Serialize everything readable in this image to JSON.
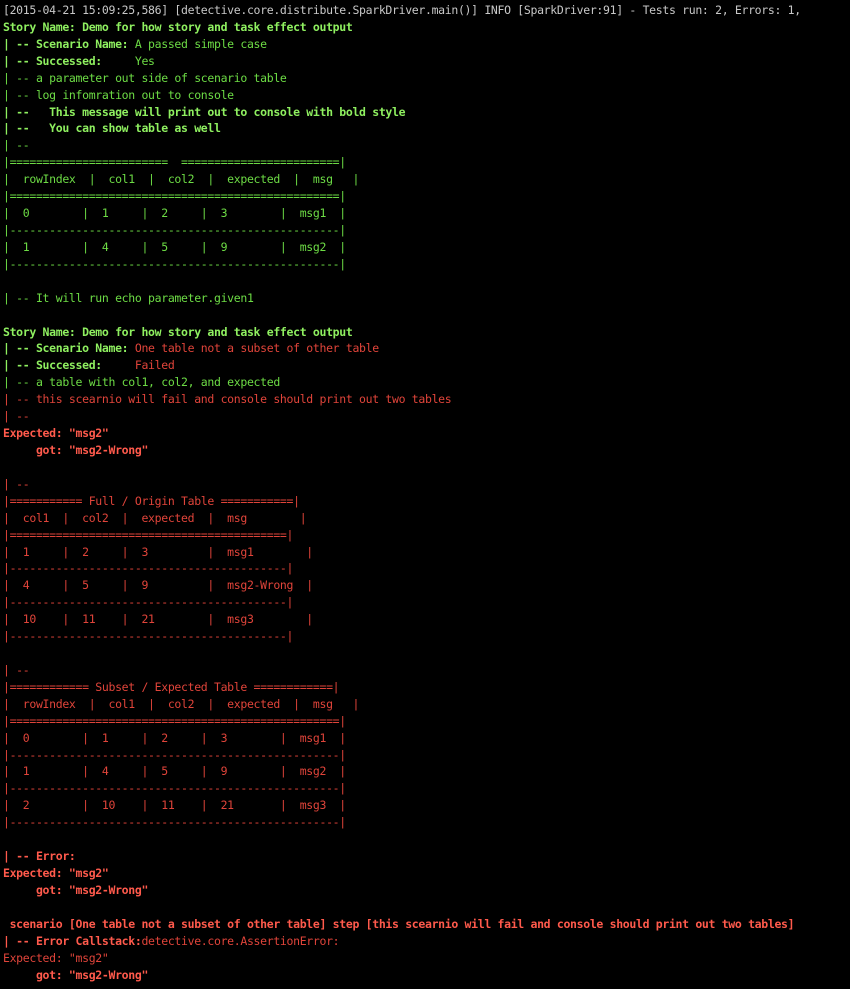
{
  "colors": {
    "background": "#000000",
    "log": "#c8c8c8",
    "green": "#6ddc45",
    "green_bright": "#8ff060",
    "red": "#e0443a",
    "red_bright": "#ff5a4c"
  },
  "lines": [
    [
      {
        "t": "[2015-04-21 15:09:25,586] [detective.core.distribute.SparkDriver.main()] INFO [SparkDriver:91] - Tests run: 2, Errors: 1,",
        "c": "log"
      }
    ],
    [
      {
        "t": "Story Name: Demo for how story and task effect output",
        "c": "green_bright",
        "b": true
      }
    ],
    [
      {
        "t": "| -- Scenario Name: ",
        "c": "green_bright",
        "b": true
      },
      {
        "t": "A passed simple case",
        "c": "green"
      }
    ],
    [
      {
        "t": "| -- Successed:     ",
        "c": "green_bright",
        "b": true
      },
      {
        "t": "Yes",
        "c": "green"
      }
    ],
    [
      {
        "t": "| -- a parameter out side of scenario table",
        "c": "green"
      }
    ],
    [
      {
        "t": "| -- log infomration out to console",
        "c": "green"
      }
    ],
    [
      {
        "t": "| --   This message will print out to console with bold style",
        "c": "green_bright",
        "b": true
      }
    ],
    [
      {
        "t": "| --   You can show table as well",
        "c": "green_bright",
        "b": true
      }
    ],
    [
      {
        "t": "| --",
        "c": "green"
      }
    ],
    [
      {
        "t": "|========================  ========================|",
        "c": "green"
      }
    ],
    [
      {
        "t": "|  rowIndex  |  col1  |  col2  |  expected  |  msg   |",
        "c": "green"
      }
    ],
    [
      {
        "t": "|==================================================|",
        "c": "green"
      }
    ],
    [
      {
        "t": "|  0        |  1     |  2     |  3        |  msg1  |",
        "c": "green"
      }
    ],
    [
      {
        "t": "|--------------------------------------------------|",
        "c": "green"
      }
    ],
    [
      {
        "t": "|  1        |  4     |  5     |  9        |  msg2  |",
        "c": "green"
      }
    ],
    [
      {
        "t": "|--------------------------------------------------|",
        "c": "green"
      }
    ],
    [
      {
        "t": "",
        "c": "green"
      }
    ],
    [
      {
        "t": "| -- It will run echo parameter.given1",
        "c": "green"
      }
    ],
    [
      {
        "t": "",
        "c": "green"
      }
    ],
    [
      {
        "t": "Story Name: Demo for how story and task effect output",
        "c": "green_bright",
        "b": true
      }
    ],
    [
      {
        "t": "| -- Scenario Name: ",
        "c": "green_bright",
        "b": true
      },
      {
        "t": "One table not a subset of other table",
        "c": "red"
      }
    ],
    [
      {
        "t": "| -- Successed:     ",
        "c": "green_bright",
        "b": true
      },
      {
        "t": "Failed",
        "c": "red"
      }
    ],
    [
      {
        "t": "| -- a table with col1, col2, and expected",
        "c": "green"
      }
    ],
    [
      {
        "t": "| -- this scearnio will fail and console should print out two tables",
        "c": "red"
      }
    ],
    [
      {
        "t": "| --",
        "c": "red"
      }
    ],
    [
      {
        "t": "Expected: \"msg2\"",
        "c": "red_bright",
        "b": true
      }
    ],
    [
      {
        "t": "     got: \"msg2-Wrong\"",
        "c": "red_bright",
        "b": true
      }
    ],
    [
      {
        "t": "",
        "c": "red"
      }
    ],
    [
      {
        "t": "| --",
        "c": "red"
      }
    ],
    [
      {
        "t": "|=========== Full / Origin Table ===========|",
        "c": "red"
      }
    ],
    [
      {
        "t": "|  col1  |  col2  |  expected  |  msg        |",
        "c": "red"
      }
    ],
    [
      {
        "t": "|==========================================|",
        "c": "red"
      }
    ],
    [
      {
        "t": "|  1     |  2     |  3         |  msg1        |",
        "c": "red"
      }
    ],
    [
      {
        "t": "|------------------------------------------|",
        "c": "red"
      }
    ],
    [
      {
        "t": "|  4     |  5     |  9         |  msg2-Wrong  |",
        "c": "red"
      }
    ],
    [
      {
        "t": "|------------------------------------------|",
        "c": "red"
      }
    ],
    [
      {
        "t": "|  10    |  11    |  21        |  msg3        |",
        "c": "red"
      }
    ],
    [
      {
        "t": "|------------------------------------------|",
        "c": "red"
      }
    ],
    [
      {
        "t": "",
        "c": "red"
      }
    ],
    [
      {
        "t": "| --",
        "c": "red"
      }
    ],
    [
      {
        "t": "|============ Subset / Expected Table ============|",
        "c": "red"
      }
    ],
    [
      {
        "t": "|  rowIndex  |  col1  |  col2  |  expected  |  msg   |",
        "c": "red"
      }
    ],
    [
      {
        "t": "|==================================================|",
        "c": "red"
      }
    ],
    [
      {
        "t": "|  0        |  1     |  2     |  3        |  msg1  |",
        "c": "red"
      }
    ],
    [
      {
        "t": "|--------------------------------------------------|",
        "c": "red"
      }
    ],
    [
      {
        "t": "|  1        |  4     |  5     |  9        |  msg2  |",
        "c": "red"
      }
    ],
    [
      {
        "t": "|--------------------------------------------------|",
        "c": "red"
      }
    ],
    [
      {
        "t": "|  2        |  10    |  11    |  21       |  msg3  |",
        "c": "red"
      }
    ],
    [
      {
        "t": "|--------------------------------------------------|",
        "c": "red"
      }
    ],
    [
      {
        "t": "",
        "c": "red"
      }
    ],
    [
      {
        "t": "| -- Error:",
        "c": "red_bright",
        "b": true
      }
    ],
    [
      {
        "t": "Expected: \"msg2\"",
        "c": "red_bright",
        "b": true
      }
    ],
    [
      {
        "t": "     got: \"msg2-Wrong\"",
        "c": "red_bright",
        "b": true
      }
    ],
    [
      {
        "t": "",
        "c": "red"
      }
    ],
    [
      {
        "t": " scenario [One table not a subset of other table] step [this scearnio will fail and console should print out two tables]",
        "c": "red_bright",
        "b": true
      }
    ],
    [
      {
        "t": "| -- Error Callstack:",
        "c": "red_bright",
        "b": true
      },
      {
        "t": "detective.core.AssertionError:",
        "c": "red"
      }
    ],
    [
      {
        "t": "Expected: \"msg2\"",
        "c": "red"
      }
    ],
    [
      {
        "t": "     got: \"msg2-Wrong\"",
        "c": "red_bright",
        "b": true
      }
    ]
  ]
}
